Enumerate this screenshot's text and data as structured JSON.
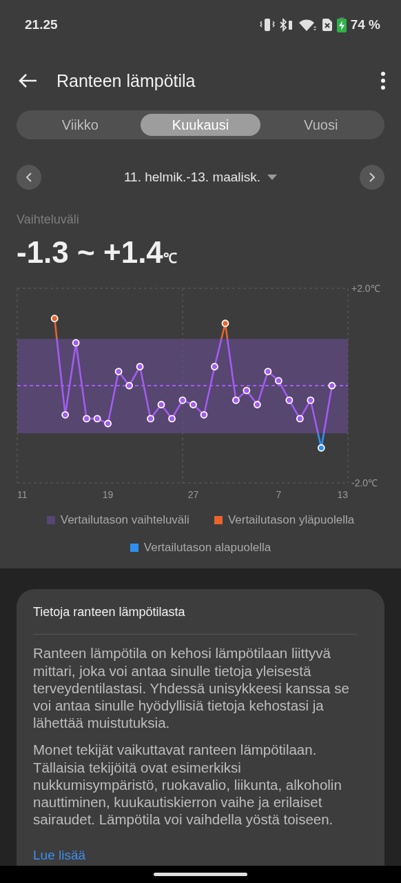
{
  "status_bar": {
    "time": "21.25",
    "battery": "74 %"
  },
  "header": {
    "title": "Ranteen lämpötila"
  },
  "tabs": [
    {
      "label": "Viikko",
      "selected": false
    },
    {
      "label": "Kuukausi",
      "selected": true
    },
    {
      "label": "Vuosi",
      "selected": false
    }
  ],
  "date_range": {
    "label": "11. helmik.-13. maalisk."
  },
  "range": {
    "label": "Vaihteluväli",
    "value": "-1.3 ~ +1.4",
    "unit": "℃"
  },
  "chart": {
    "chart_data": {
      "type": "line",
      "categories": [
        "11",
        null,
        null,
        null,
        null,
        null,
        null,
        null,
        "19",
        null,
        null,
        null,
        null,
        null,
        null,
        null,
        "27",
        null,
        null,
        null,
        null,
        null,
        null,
        null,
        "7",
        null,
        null,
        null,
        null,
        null,
        "13"
      ],
      "series": [
        {
          "color": "#a25cf0",
          "marker": "circle",
          "values": [
            null,
            null,
            null,
            1.38,
            -0.6,
            0.88,
            -0.68,
            -0.68,
            -0.78,
            0.29,
            0,
            0.39,
            -0.68,
            -0.39,
            -0.68,
            -0.3,
            -0.39,
            -0.6,
            0.39,
            1.28,
            -0.3,
            -0.1,
            -0.39,
            0.29,
            0.1,
            -0.3,
            -0.68,
            -0.3,
            -1.28,
            0,
            null
          ]
        }
      ],
      "ylim": [
        -2,
        2
      ],
      "yticks": [
        {
          "value": 2,
          "label": "+2.0℃"
        },
        {
          "value": -2,
          "label": "-2.0℃"
        }
      ]
    }
  },
  "legend": [
    {
      "label": "Vertailutason vaihteluväli",
      "color": "#564670"
    },
    {
      "label": "Vertailutason yläpuolella",
      "color": "#e8642c"
    },
    {
      "label": "Vertailutason alapuolella",
      "color": "#2f8ff0"
    }
  ],
  "info_card": {
    "title": "Tietoja ranteen lämpötilasta",
    "paragraphs": [
      "Ranteen lämpötila on kehosi lämpötilaan liittyvä mittari, joka voi antaa sinulle tietoja yleisestä terveydentilastasi. Yhdessä unisykkeesi kanssa se voi antaa sinulle hyödyllisiä tietoja kehostasi ja lähettää muistutuksia.",
      "Monet tekijät vaikuttavat ranteen lämpötilaan. Tällaisia tekijöitä ovat esimerkiksi nukkumisympäristö, ruokavalio, liikunta, alkoholin nauttiminen, kuukautiskierron vaihe ja erilaiset sairaudet. Lämpötila voi vaihdella yöstä toiseen."
    ],
    "link": "Lue lisää"
  }
}
